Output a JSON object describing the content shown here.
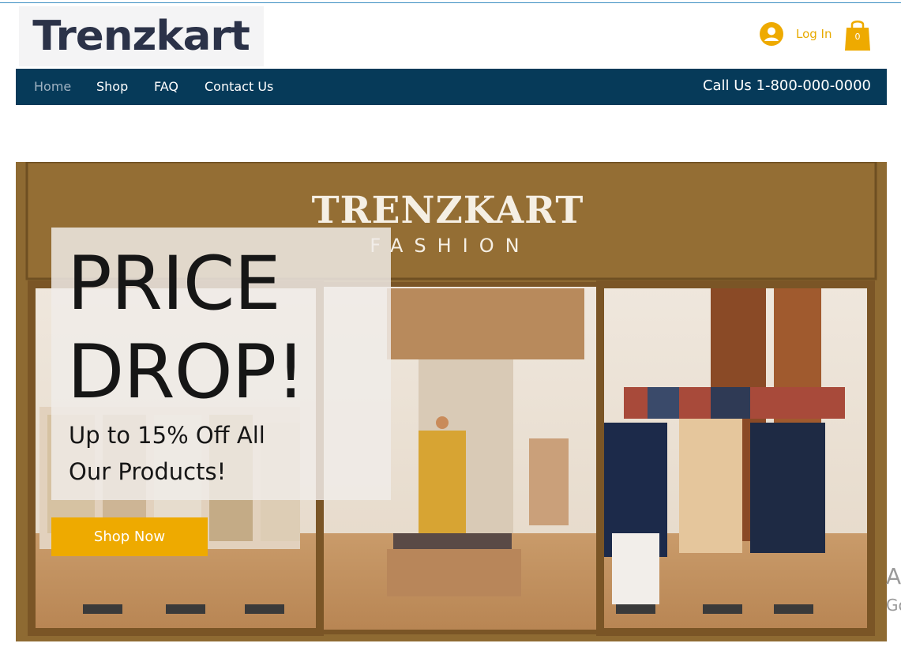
{
  "header": {
    "logo_text": "Trenzkart",
    "login_label": "Log In",
    "cart_count": "0"
  },
  "nav": {
    "items": [
      {
        "label": "Home",
        "active": true
      },
      {
        "label": "Shop",
        "active": false
      },
      {
        "label": "FAQ",
        "active": false
      },
      {
        "label": "Contact Us",
        "active": false
      }
    ],
    "phone": "Call Us 1-800-000-0000"
  },
  "hero": {
    "store_title": "TRENZKART",
    "store_subtitle": "FASHION",
    "promo_title_line1": "PRICE",
    "promo_title_line2": "DROP!",
    "promo_sub_line1": "Up to 15% Off All",
    "promo_sub_line2": "Our Products!",
    "cta_label": "Shop Now"
  },
  "edge_fragments": {
    "a": "A",
    "g": "Go"
  },
  "colors": {
    "accent": "#eeaa00",
    "nav_bg": "#063a59",
    "logo_text": "#2b3248"
  },
  "icons": [
    "user-avatar-icon",
    "shopping-bag-icon"
  ]
}
